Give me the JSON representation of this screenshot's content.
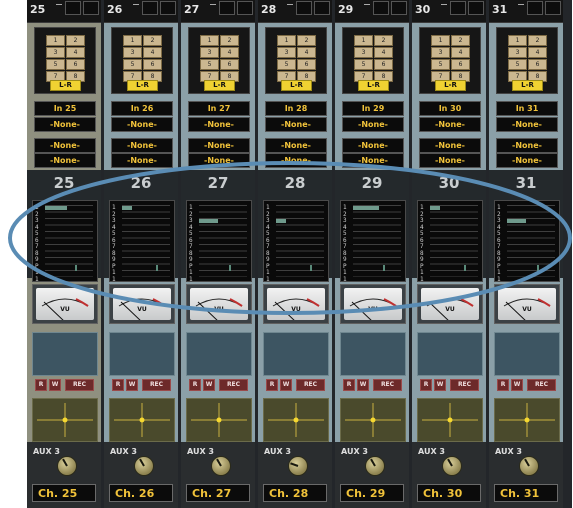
{
  "bus_buttons": [
    "1",
    "2",
    "3",
    "4",
    "5",
    "6",
    "7",
    "8"
  ],
  "lr_label": "L-R",
  "none_label": "-None-",
  "aux_label": "AUX 3",
  "rw_buttons": {
    "r": "R",
    "w": "W",
    "rec": "REC"
  },
  "vu_label": "VU",
  "meter_scale": [
    "1",
    "2",
    "3",
    "4",
    "5",
    "6",
    "7",
    "8",
    "9",
    "P",
    "1",
    "1"
  ],
  "channels": [
    {
      "num": "25",
      "input": "In 25",
      "name": "Ch. 25",
      "knob_angle": -30,
      "meter": {
        "bar_width_pct": 45,
        "bar_row": 0
      }
    },
    {
      "num": "26",
      "input": "In 26",
      "name": "Ch. 26",
      "knob_angle": -30,
      "meter": {
        "bar_width_pct": 20,
        "bar_row": 0
      }
    },
    {
      "num": "27",
      "input": "In 27",
      "name": "Ch. 27",
      "knob_angle": -30,
      "meter": {
        "bar_width_pct": 40,
        "bar_row": 2
      }
    },
    {
      "num": "28",
      "input": "In 28",
      "name": "Ch. 28",
      "knob_angle": -70,
      "meter": {
        "bar_width_pct": 20,
        "bar_row": 2
      }
    },
    {
      "num": "29",
      "input": "In 29",
      "name": "Ch. 29",
      "knob_angle": -30,
      "meter": {
        "bar_width_pct": 55,
        "bar_row": 0
      }
    },
    {
      "num": "30",
      "input": "In 30",
      "name": "Ch. 30",
      "knob_angle": -30,
      "meter": {
        "bar_width_pct": 20,
        "bar_row": 0
      }
    },
    {
      "num": "31",
      "input": "In 31",
      "name": "Ch. 31",
      "knob_angle": -30,
      "meter": {
        "bar_width_pct": 40,
        "bar_row": 2
      }
    }
  ],
  "colors": {
    "field_text": "#f0c23a",
    "lr": "#f0d232",
    "annotation": "#5a8cb4"
  }
}
